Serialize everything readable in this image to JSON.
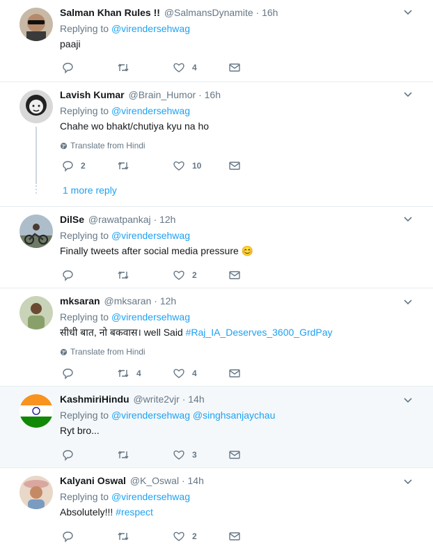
{
  "tweets": [
    {
      "name": "Salman Khan Rules !!",
      "handle": "@SalmansDynamite",
      "dot": "·",
      "time": "16h",
      "replying_prefix": "Replying to",
      "replying_to": "@virendersehwag",
      "replying_to_extra": "",
      "text": "paaji",
      "text_hashtag": "",
      "emoji": "",
      "translate": "",
      "replies": "",
      "retweets": "",
      "likes": "4"
    },
    {
      "name": "Lavish Kumar",
      "handle": "@Brain_Humor",
      "dot": "·",
      "time": "16h",
      "replying_prefix": "Replying to",
      "replying_to": "@virendersehwag",
      "replying_to_extra": "",
      "text": "Chahe wo bhakt/chutiya kyu na ho",
      "text_hashtag": "",
      "emoji": "",
      "translate": "Translate from Hindi",
      "replies": "2",
      "retweets": "",
      "likes": "10",
      "more_reply": "1 more reply"
    },
    {
      "name": "DilSe",
      "handle": "@rawatpankaj",
      "dot": "·",
      "time": "12h",
      "replying_prefix": "Replying to",
      "replying_to": "@virendersehwag",
      "replying_to_extra": "",
      "text": "Finally tweets after social media pressure",
      "text_hashtag": "",
      "emoji": "😊",
      "translate": "",
      "replies": "",
      "retweets": "",
      "likes": "2"
    },
    {
      "name": "mksaran",
      "handle": "@mksaran",
      "dot": "·",
      "time": "12h",
      "replying_prefix": "Replying to",
      "replying_to": "@virendersehwag",
      "replying_to_extra": "",
      "text": "सीधी बात, नो बकवास। well Said ",
      "text_hashtag": "#Raj_IA_Deserves_3600_GrdPay",
      "emoji": "",
      "translate": "Translate from Hindi",
      "replies": "",
      "retweets": "4",
      "likes": "4"
    },
    {
      "name": "KashmiriHindu",
      "handle": "@write2vjr",
      "dot": "·",
      "time": "14h",
      "replying_prefix": "Replying to",
      "replying_to": "@virendersehwag",
      "replying_to_extra": "@singhsanjaychau",
      "text": "Ryt bro...",
      "text_hashtag": "",
      "emoji": "",
      "translate": "",
      "replies": "",
      "retweets": "",
      "likes": "3"
    },
    {
      "name": "Kalyani Oswal",
      "handle": "@K_Oswal",
      "dot": "·",
      "time": "14h",
      "replying_prefix": "Replying to",
      "replying_to": "@virendersehwag",
      "replying_to_extra": "",
      "text": "Absolutely!!! ",
      "text_hashtag": "#respect",
      "emoji": "",
      "translate": "",
      "replies": "",
      "retweets": "",
      "likes": "2"
    }
  ],
  "colors": {
    "link": "#1da1f2",
    "muted": "#657786",
    "border": "#e6ecf0",
    "highlight_bg": "#f5f8fa"
  }
}
